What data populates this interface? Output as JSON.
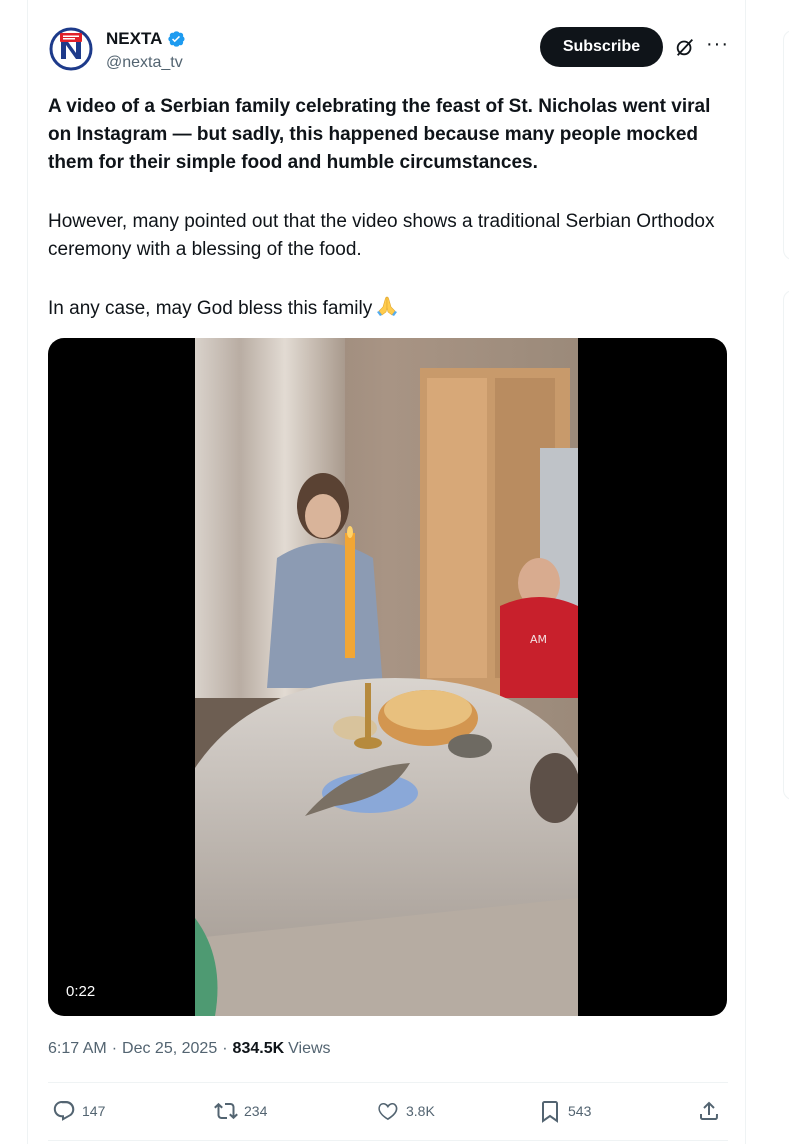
{
  "author": {
    "name": "NEXTA",
    "handle": "@nexta_tv",
    "avatar_icon": "nexta-logo-icon",
    "verified_icon": "verified-badge-icon"
  },
  "header_actions": {
    "subscribe_label": "Subscribe",
    "grok_icon": "grok-icon",
    "more_icon": "more-icon"
  },
  "post": {
    "paragraph1": "A video of a Serbian family celebrating the feast of St. Nicholas went viral on Instagram — but sadly, this happened because many people mocked them for their simple food and humble circumstances.",
    "paragraph2": " However, many pointed out that the video shows a traditional Serbian Orthodox ceremony with a blessing of the food.",
    "paragraph3": "In any case, may God bless this family",
    "paragraph3_emoji": "🙏"
  },
  "media": {
    "duration": "0:22"
  },
  "meta": {
    "time": "6:17 AM",
    "separator": "·",
    "date": "Dec 25, 2025",
    "views_count": "834.5K",
    "views_label": "Views"
  },
  "actions": {
    "replies": "147",
    "reposts": "234",
    "likes": "3.8K",
    "bookmarks": "543"
  },
  "colors": {
    "text_primary": "#0f1419",
    "text_secondary": "#536471",
    "verified_blue": "#1d9bf0",
    "subscribe_bg": "#0f1419",
    "divider": "#eff3f4"
  }
}
